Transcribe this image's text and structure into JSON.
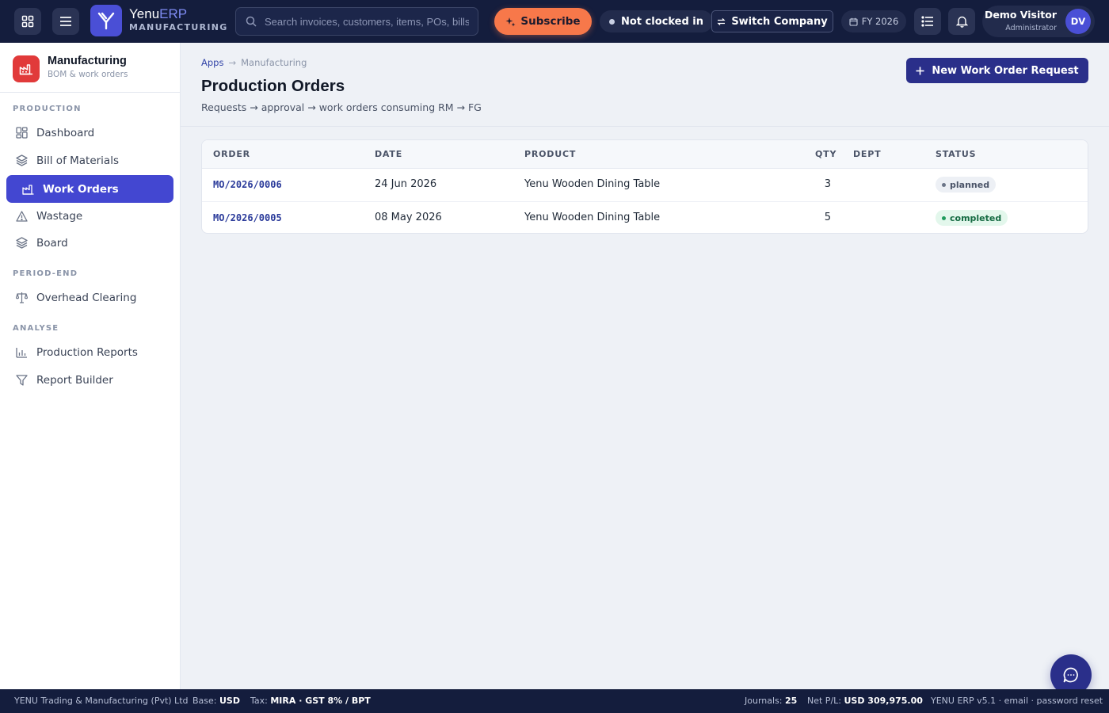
{
  "topbar": {
    "brand_prefix": "Yenu",
    "brand_suffix": "ERP",
    "brand_sub": "MANUFACTURING",
    "search_placeholder": "Search invoices, customers, items, POs, bills…",
    "subscribe_label": "Subscribe",
    "clock_status": "Not clocked in",
    "switch_company_label": "Switch Company",
    "fiscal_year": "FY 2026",
    "user_name": "Demo Visitor",
    "user_role": "Administrator",
    "user_initials": "DV"
  },
  "sidebar": {
    "app_title": "Manufacturing",
    "app_subtitle": "BOM & work orders",
    "sections": {
      "production": "PRODUCTION",
      "period_end": "PERIOD-END",
      "analyse": "ANALYSE"
    },
    "items": [
      {
        "label": "Dashboard",
        "icon": "dashboard-icon",
        "active": false
      },
      {
        "label": "Bill of Materials",
        "icon": "layers-icon",
        "active": false
      },
      {
        "label": "Work Orders",
        "icon": "factory-icon",
        "active": true
      },
      {
        "label": "Wastage",
        "icon": "warning-icon",
        "active": false
      },
      {
        "label": "Board",
        "icon": "layers-icon",
        "active": false
      },
      {
        "label": "Overhead Clearing",
        "icon": "scale-icon",
        "active": false
      },
      {
        "label": "Production Reports",
        "icon": "bar-chart-icon",
        "active": false
      },
      {
        "label": "Report Builder",
        "icon": "filter-icon",
        "active": false
      }
    ]
  },
  "page": {
    "breadcrumb": [
      "Apps",
      "Manufacturing"
    ],
    "title": "Production Orders",
    "subtitle": "Requests → approval → work orders consuming RM → FG",
    "new_button_label": "New Work Order Request"
  },
  "table": {
    "columns": [
      "ORDER",
      "DATE",
      "PRODUCT",
      "QTY",
      "DEPT",
      "STATUS"
    ],
    "rows": [
      {
        "order": "MO/2026/0006",
        "date": "24 Jun 2026",
        "product": "Yenu Wooden Dining Table",
        "qty": "3",
        "dept": "",
        "status": "planned"
      },
      {
        "order": "MO/2026/0005",
        "date": "08 May 2026",
        "product": "Yenu Wooden Dining Table",
        "qty": "5",
        "dept": "",
        "status": "completed"
      }
    ]
  },
  "footer": {
    "company": "YENU Trading & Manufacturing (Pvt) Ltd",
    "base_label": "Base:",
    "base_value": "USD",
    "tax_label": "Tax:",
    "tax_value": "MIRA · GST 8% / BPT",
    "journals_label": "Journals:",
    "journals_value": "25",
    "pl_label": "Net P/L:",
    "pl_value": "USD 309,975.00",
    "version_info": "YENU ERP v5.1 · email · password reset"
  },
  "colors": {
    "topbar_bg": "#141d3d",
    "accent": "#4347d1",
    "primary_button": "#2a2f8a",
    "subscribe": "#f7784a",
    "app_icon": "#e13a3a"
  }
}
